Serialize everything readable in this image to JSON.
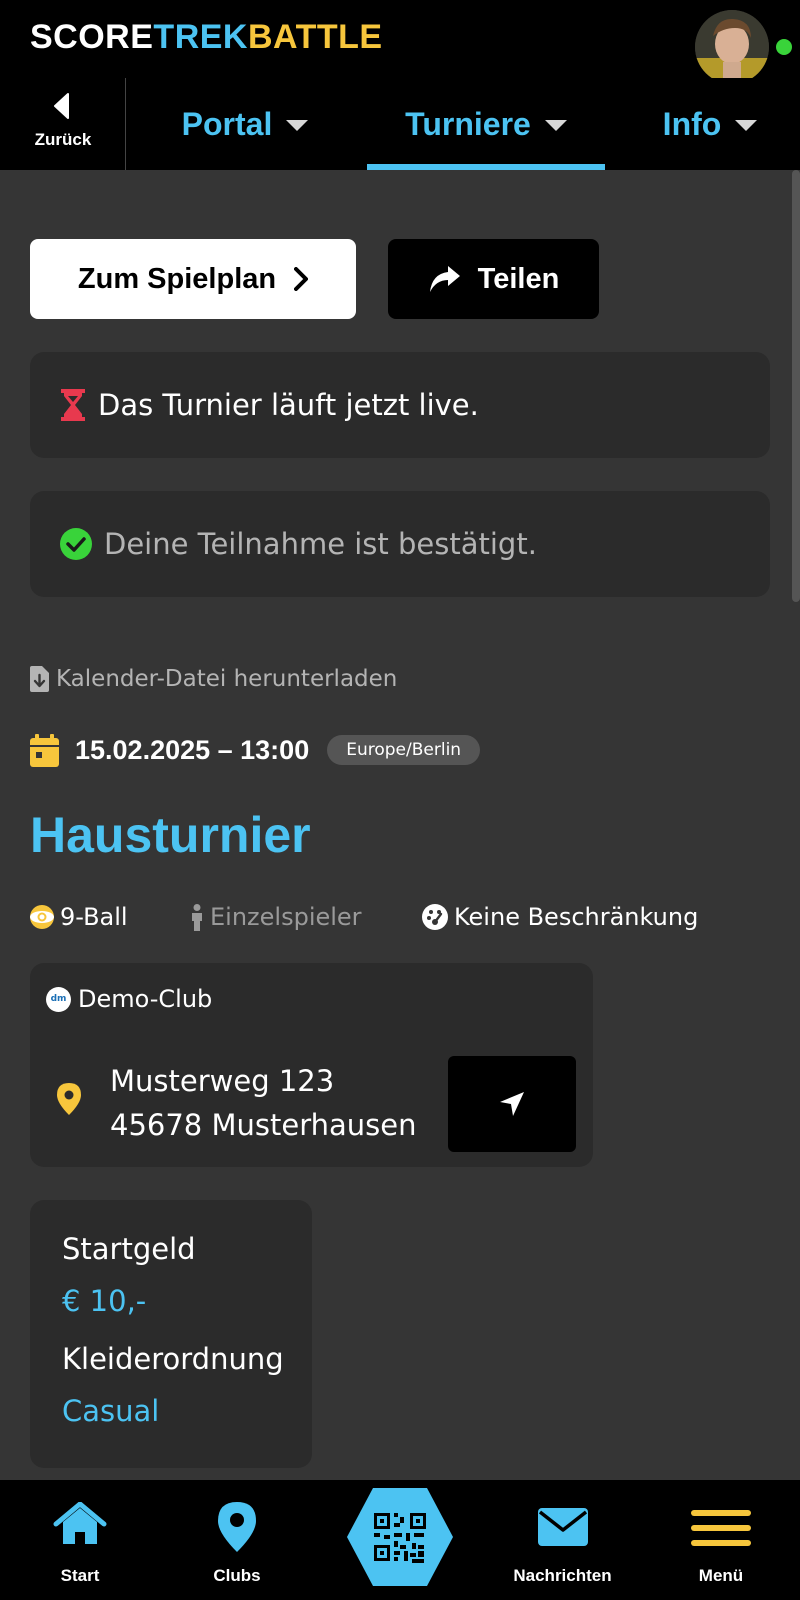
{
  "header": {
    "logo": {
      "part1": "SCORE",
      "part2": "TREK",
      "part3": "BATTLE"
    },
    "avatar_icon": "user-avatar",
    "online_color": "#39d33a"
  },
  "nav": {
    "back_label": "Zurück",
    "items": [
      {
        "label": "Portal"
      },
      {
        "label": "Turniere",
        "active": true
      },
      {
        "label": "Info"
      }
    ]
  },
  "actions": {
    "schedule_label": "Zum Spielplan",
    "share_label": "Teilen"
  },
  "status": {
    "live_text": "Das Turnier läuft jetzt live.",
    "confirmed_text": "Deine Teilnahme ist bestätigt."
  },
  "tournament": {
    "calendar_download": "Kalender-Datei herunterladen",
    "date": "15.02.2025 – 13:00",
    "timezone": "Europe/Berlin",
    "title": "Hausturnier",
    "game": "9-Ball",
    "mode": "Einzelspieler",
    "restriction": "Keine Beschränkung"
  },
  "club": {
    "name": "Demo-Club",
    "logo_text": "dm",
    "street": "Musterweg 123",
    "city": "45678 Musterhausen"
  },
  "details": {
    "fee_label": "Startgeld",
    "fee_value": "€ 10,-",
    "dress_label": "Kleiderordnung",
    "dress_value": "Casual"
  },
  "bottom_nav": {
    "items": [
      {
        "label": "Start",
        "icon": "home-icon"
      },
      {
        "label": "Clubs",
        "icon": "map-pin-icon"
      },
      {
        "label": "",
        "icon": "qr-code-icon"
      },
      {
        "label": "Nachrichten",
        "icon": "envelope-icon"
      },
      {
        "label": "Menü",
        "icon": "hamburger-icon"
      }
    ]
  },
  "colors": {
    "accent": "#4cc3f2",
    "gold": "#f7c63c",
    "live": "#e8394e",
    "confirmed": "#39d33a"
  }
}
